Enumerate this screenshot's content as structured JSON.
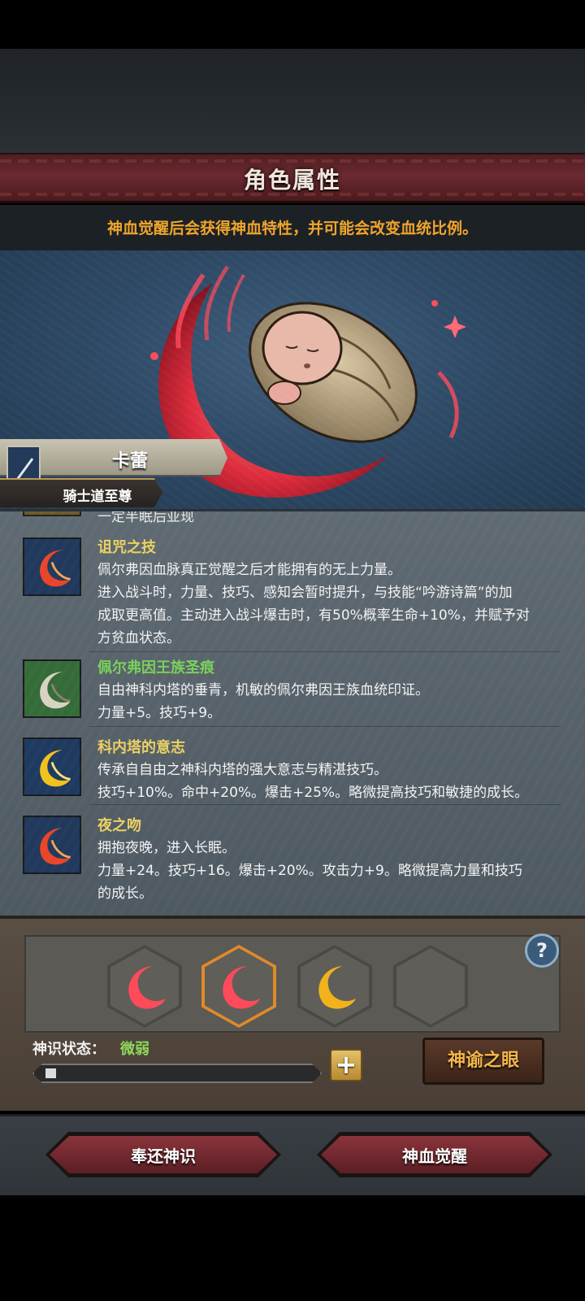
{
  "header": {
    "title": "角色属性"
  },
  "notice": {
    "text": "神血觉醒后会获得神血特性，并可能会改变血统比例。"
  },
  "character": {
    "name": "卡蕾",
    "title": "骑士道至尊"
  },
  "traits_panel": {
    "cutoff_text": "一定半眠后亚现",
    "traits": [
      {
        "name": "诅咒之技",
        "icon": "red-crescent-icon",
        "lines": [
          "佩尔弗因血脉真正觉醒之后才能拥有的无上力量。",
          "进入战斗时，力量、技巧、感知会暂时提升，与技能“吟游诗篇”的加",
          "成取更高值。主动进入战斗爆击时，有50%概率生命+10%，并赋予对",
          "方贫血状态。"
        ]
      },
      {
        "name": "佩尔弗因王族圣痕",
        "icon": "white-crescent-icon",
        "lines": [
          "自由神科内塔的垂青，机敏的佩尔弗因王族血统印证。",
          "力量+5。技巧+9。"
        ]
      },
      {
        "name": "科内塔的意志",
        "icon": "yellow-crescent-icon",
        "lines": [
          "传承自自由之神科内塔的强大意志与精湛技巧。",
          "技巧+10%。命中+20%。爆击+25%。略微提高技巧和敏捷的成长。"
        ]
      },
      {
        "name": "夜之吻",
        "icon": "red-crescent-icon",
        "lines": [
          "拥抱夜晚，进入长眠。",
          "力量+24。技巧+16。爆击+20%。攻击力+9。略微提高力量和技巧",
          "的成长。"
        ]
      }
    ]
  },
  "slots": [
    "red-moon-slot",
    "red-moon-slot-selected",
    "gold-moon-slot",
    "empty-slot"
  ],
  "divine_sense": {
    "label": "神识状态：",
    "value": "微弱",
    "progress": 0.04
  },
  "buttons": {
    "help": "?",
    "plus": "+",
    "oracle_eye": "神谕之眼",
    "return_sense": "奉还神识",
    "awaken": "神血觉醒"
  },
  "colors": {
    "accent_orange": "#f0a52b",
    "trait_yellow": "#ead063",
    "trait_green": "#78d05a",
    "status_green": "#8fd85a"
  }
}
